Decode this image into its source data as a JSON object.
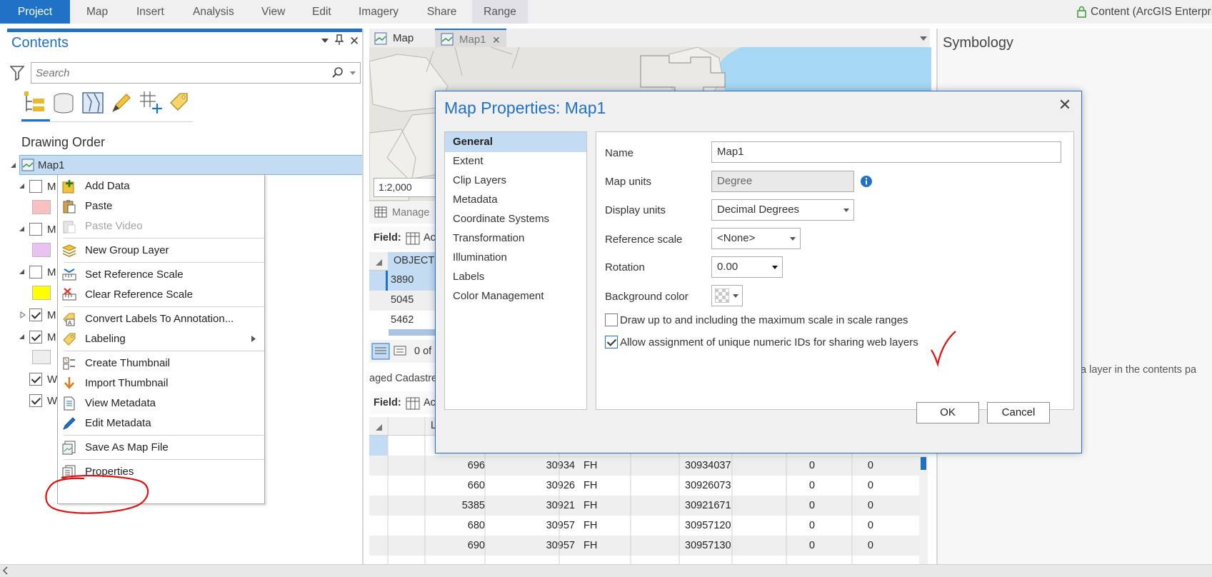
{
  "ribbon": {
    "tabs": [
      "Project",
      "Map",
      "Insert",
      "Analysis",
      "View",
      "Edit",
      "Imagery",
      "Share",
      "Range"
    ],
    "active_tab": "Project",
    "portal_label": "Content (ArcGIS Enterpris"
  },
  "contents": {
    "title": "Contents",
    "search_placeholder": "Search",
    "section_title": "Drawing Order",
    "map_node": "Map1",
    "layer_rows": [
      {
        "label": "M",
        "checked": false,
        "swatch": "#f8c0c0"
      },
      {
        "label": "M",
        "checked": false,
        "swatch": "#e9c1f2"
      },
      {
        "label": "M",
        "checked": false,
        "swatch": "#ffff00"
      },
      {
        "label": "M",
        "checked": true
      },
      {
        "label": "M",
        "checked": true,
        "swatch": "#eeeeee"
      },
      {
        "label": "W",
        "checked": true
      },
      {
        "label": "W",
        "checked": true
      }
    ]
  },
  "context_menu": {
    "items": [
      {
        "label": "Add Data",
        "icon": "add-data-icon"
      },
      {
        "label": "Paste",
        "icon": "paste-icon"
      },
      {
        "label": "Paste Video",
        "icon": "paste-video-icon",
        "disabled": true
      },
      {
        "label": "New Group Layer",
        "icon": "group-layer-icon"
      },
      {
        "label": "Set Reference Scale",
        "icon": "set-scale-icon"
      },
      {
        "label": "Clear Reference Scale",
        "icon": "clear-scale-icon"
      },
      {
        "label": "Convert Labels To Annotation...",
        "icon": "convert-labels-icon"
      },
      {
        "label": "Labeling",
        "icon": "labeling-icon",
        "submenu": true
      },
      {
        "label": "Create Thumbnail",
        "icon": "create-thumbnail-icon"
      },
      {
        "label": "Import Thumbnail",
        "icon": "import-thumbnail-icon"
      },
      {
        "label": "View Metadata",
        "icon": "view-metadata-icon"
      },
      {
        "label": "Edit Metadata",
        "icon": "edit-metadata-icon"
      },
      {
        "label": "Save As Map File",
        "icon": "save-map-file-icon"
      },
      {
        "label": "Properties",
        "icon": "properties-icon"
      }
    ]
  },
  "map_view": {
    "tabs": [
      "Map",
      "Map1"
    ],
    "scale": "1:2,000"
  },
  "attribute_table_top": {
    "title": "Manage",
    "field_label": "Field:",
    "field_btn": "Ac",
    "column": "OBJECTI",
    "rows": [
      "3890",
      "5045",
      "5462"
    ],
    "status": "0 of"
  },
  "attribute_table_bottom": {
    "title": "aged Cadastre",
    "field_label": "Field:",
    "field_btn": "Ac",
    "column": "L",
    "rows": [
      [
        "696",
        "30934",
        "FH",
        "30934037",
        "0",
        "0"
      ],
      [
        "660",
        "30926",
        "FH",
        "30926073",
        "0",
        "0"
      ],
      [
        "5385",
        "30921",
        "FH",
        "30921671",
        "0",
        "0"
      ],
      [
        "680",
        "30957",
        "FH",
        "30957120",
        "0",
        "0"
      ],
      [
        "690",
        "30957",
        "FH",
        "30957130",
        "0",
        "0"
      ]
    ]
  },
  "symbology": {
    "title": "Symbology",
    "hint": "t a layer in the contents pa"
  },
  "dialog": {
    "title": "Map Properties: Map1",
    "nav": [
      "General",
      "Extent",
      "Clip Layers",
      "Metadata",
      "Coordinate Systems",
      "Transformation",
      "Illumination",
      "Labels",
      "Color Management"
    ],
    "selected_nav": "General",
    "fields": {
      "name_label": "Name",
      "name_value": "Map1",
      "map_units_label": "Map units",
      "map_units_value": "Degree",
      "display_units_label": "Display units",
      "display_units_value": "Decimal Degrees",
      "reference_scale_label": "Reference scale",
      "reference_scale_value": "<None>",
      "rotation_label": "Rotation",
      "rotation_value": "0.00",
      "background_color_label": "Background color"
    },
    "checkboxes": [
      {
        "label": "Draw up to and including the maximum scale in scale ranges",
        "checked": false
      },
      {
        "label": "Allow assignment of unique numeric IDs for sharing web layers",
        "checked": true
      }
    ],
    "ok_label": "OK",
    "cancel_label": "Cancel"
  },
  "colors": {
    "accent": "#1f72c6",
    "annotation": "#e01010",
    "selection": "#c3dcf3"
  }
}
